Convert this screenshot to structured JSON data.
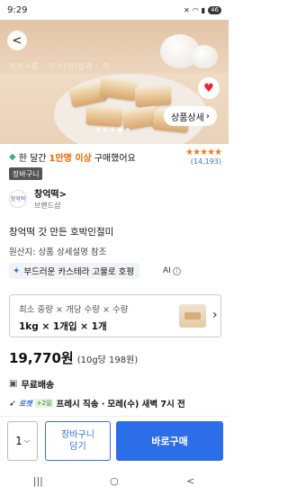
{
  "status_bar": {
    "time": "9:29",
    "battery": "46"
  },
  "hero": {
    "ghost_text": "떡마시롱 · 간식/떡/빙과 · 떡",
    "detail_label": "상품상세",
    "slide_count": 5,
    "active_slide": 3
  },
  "social_proof": {
    "prefix": "한 달간",
    "highlight": "1만명 이상",
    "suffix": "구매했어요",
    "rating": 5,
    "review_count": "(14,193)"
  },
  "cart_tag": "장바구니",
  "brand": {
    "name": "창억떡",
    "chevron": ">",
    "sub": "브랜드샵",
    "logo_text": "창억떡"
  },
  "product": {
    "title": "창억떡 갓 만든 호박인절미",
    "origin": "원산지: 상품 상세설명 참조"
  },
  "ai_summary": {
    "text": "부드러운 카스테라 고물로 호평",
    "label": "AI"
  },
  "option": {
    "label": "최소 중량 × 개당 수량 × 수량",
    "value": "1kg × 1개입 × 1개"
  },
  "price": {
    "main": "19,770원",
    "unit": "(10g당 198원)"
  },
  "shipping": {
    "label": "무료배송"
  },
  "rocket": {
    "badge": "로켓",
    "plus": "+2일",
    "text1": "프레시 직송 · ",
    "text2": "모레(수) 새벽 7시 전"
  },
  "bottom": {
    "quantity": "1",
    "cart_button": "장바구니\n담기",
    "buy_button": "바로구매"
  },
  "nav": {
    "recent": "|||",
    "home": "○",
    "back": "<"
  },
  "colors": {
    "accent_blue": "#2c6ee8",
    "star_orange": "#f27a1a",
    "highlight_orange": "#e60"
  }
}
